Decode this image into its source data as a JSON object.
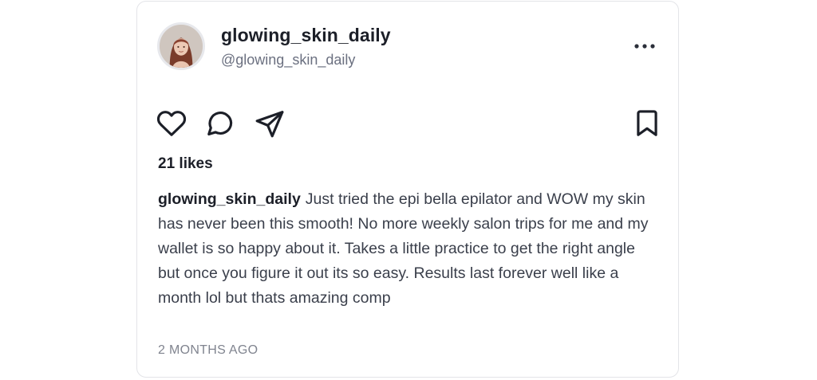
{
  "post": {
    "username": "glowing_skin_daily",
    "handle": "@glowing_skin_daily",
    "likes": "21 likes",
    "caption": {
      "username": "glowing_skin_daily",
      "text": "Just tried the epi bella epilator and WOW my skin has never been this smooth! No more weekly salon trips for me and my wallet is so happy about it. Takes a little practice to get the right angle but once you figure it out its so easy. Results last forever well like a month lol but thats amazing comp"
    },
    "timestamp": "2 MONTHS AGO"
  },
  "icons": {
    "more": "more-horizontal-icon",
    "like": "heart-icon",
    "comment": "comment-icon",
    "share": "send-icon",
    "save": "bookmark-icon"
  },
  "colors": {
    "text_primary": "#1c1f28",
    "text_secondary": "#6b7080",
    "border": "#e3e4e8"
  }
}
